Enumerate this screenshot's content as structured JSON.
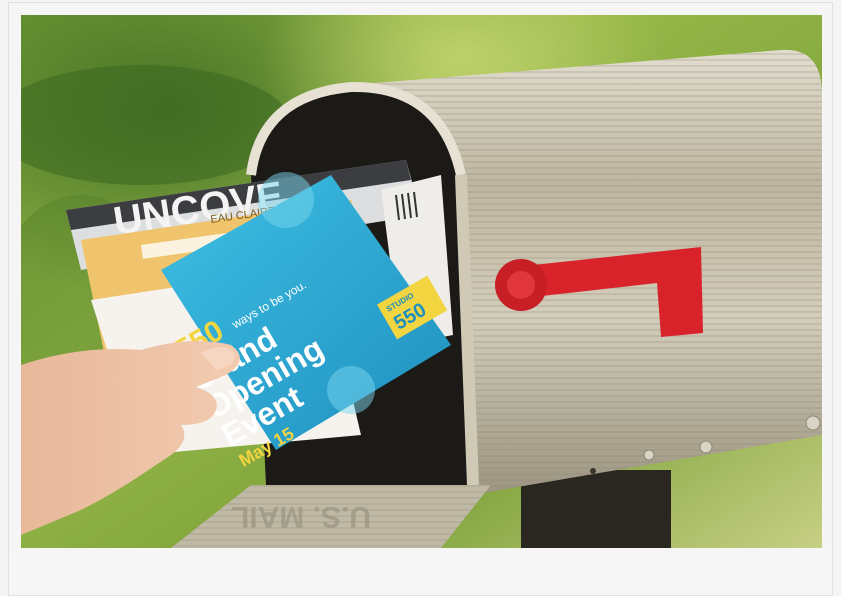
{
  "photo": {
    "magazine_text": "UNCOVE",
    "envelope_text": "EAU CLAIRE",
    "postcard": {
      "number": "550",
      "tagline": "ways to be you.",
      "line1": "Grand",
      "line2": "Opening",
      "line3": "Event",
      "date": "May 15",
      "logo_top": "STUDIO",
      "logo_number": "550"
    }
  }
}
